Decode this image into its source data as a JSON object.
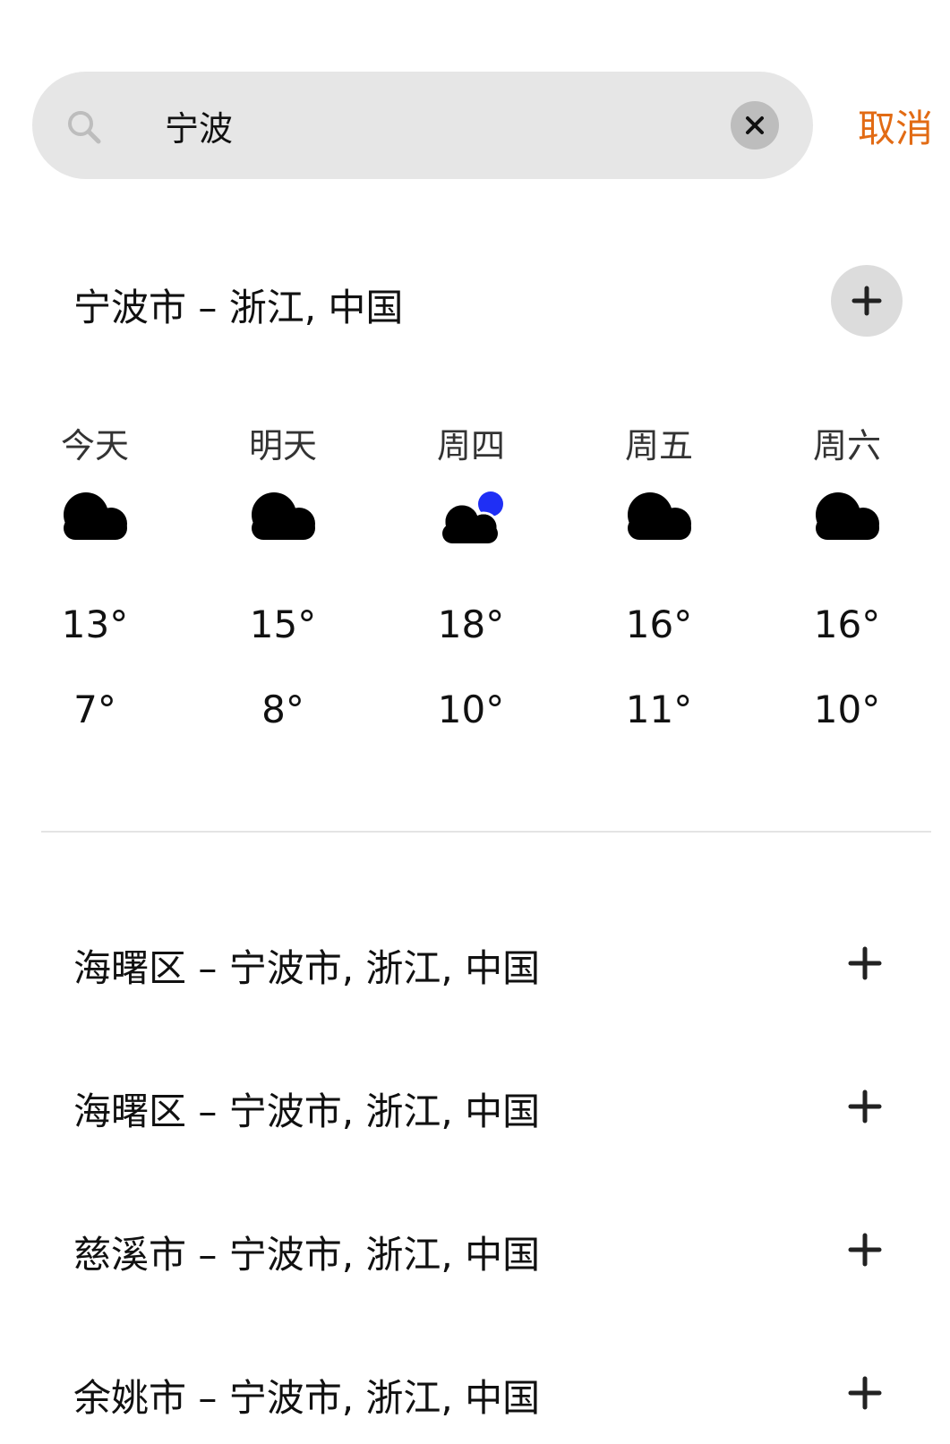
{
  "search": {
    "value": "宁波",
    "cancel_label": "取消"
  },
  "main_result": {
    "title": "宁波市 – 浙江, 中国"
  },
  "forecast": {
    "days": [
      {
        "label": "今天",
        "icon": "cloud-icon",
        "high": "13°",
        "low": "7°"
      },
      {
        "label": "明天",
        "icon": "cloud-icon",
        "high": "15°",
        "low": "8°"
      },
      {
        "label": "周四",
        "icon": "partly-cloudy-night-icon",
        "high": "18°",
        "low": "10°"
      },
      {
        "label": "周五",
        "icon": "cloud-icon",
        "high": "16°",
        "low": "11°"
      },
      {
        "label": "周六",
        "icon": "cloud-icon",
        "high": "16°",
        "low": "10°"
      }
    ]
  },
  "results": [
    {
      "label": "海曙区 – 宁波市, 浙江, 中国"
    },
    {
      "label": "海曙区 – 宁波市, 浙江, 中国"
    },
    {
      "label": "慈溪市 – 宁波市, 浙江, 中国"
    },
    {
      "label": "余姚市 – 宁波市, 浙江, 中国"
    }
  ],
  "colors": {
    "accent": "#e26b14",
    "search_background": "#e6e6e6",
    "moon": "#1f2ff5"
  }
}
